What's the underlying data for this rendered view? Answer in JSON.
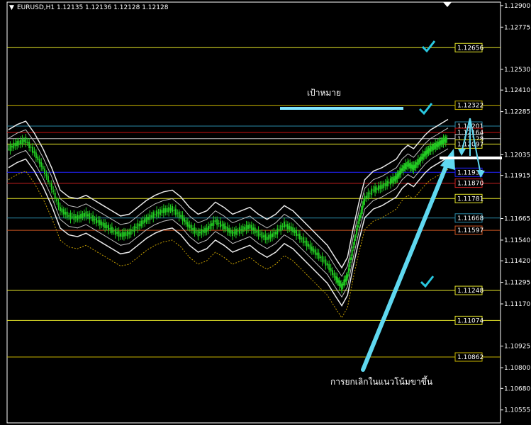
{
  "chart_data": {
    "type": "candlestick",
    "symbol_header": "EURUSD,H1  1.12135 1.12136 1.12128 1.12128",
    "ylim": [
      1.1048,
      1.1292
    ],
    "grid": false,
    "y_ticks": [
      "1.12900",
      "1.12775",
      "1.12530",
      "1.12410",
      "1.12285",
      "1.12035",
      "1.11915",
      "1.11665",
      "1.11540",
      "1.11420",
      "1.11295",
      "1.11170",
      "1.10925",
      "1.10800",
      "1.10680",
      "1.10555"
    ],
    "price_levels": [
      {
        "label": "1.12656",
        "value": 1.12656,
        "color": "#e6e629",
        "style": "solid"
      },
      {
        "label": "1.12322",
        "value": 1.12322,
        "color": "#c8b400",
        "style": "solid"
      },
      {
        "label": "1.12201",
        "value": 1.12201,
        "color": "#2a8aa8",
        "style": "solid"
      },
      {
        "label": "1.12164",
        "value": 1.12164,
        "color": "#cc1111",
        "style": "solid"
      },
      {
        "label": "1.12128",
        "value": 1.12128,
        "color": "#c0c0c0",
        "style": "solid"
      },
      {
        "label": "1.12097",
        "value": 1.12097,
        "color": "#e6e629",
        "style": "solid"
      },
      {
        "label": "1.11933",
        "value": 1.11933,
        "color": "#2222ff",
        "style": "solid"
      },
      {
        "label": "1.11870",
        "value": 1.1187,
        "color": "#cc2222",
        "style": "solid"
      },
      {
        "label": "1.11781",
        "value": 1.11781,
        "color": "#e6e629",
        "style": "solid"
      },
      {
        "label": "1.11668",
        "value": 1.11668,
        "color": "#2a8aa8",
        "style": "solid"
      },
      {
        "label": "1.11597",
        "value": 1.11597,
        "color": "#cc5522",
        "style": "solid"
      },
      {
        "label": "1.11248",
        "value": 1.11248,
        "color": "#e6e629",
        "style": "solid"
      },
      {
        "label": "1.11074",
        "value": 1.11074,
        "color": "#e6e629",
        "style": "solid"
      },
      {
        "label": "1.10862",
        "value": 1.10862,
        "color": "#c8b400",
        "style": "solid"
      }
    ],
    "annotations": {
      "target_label": "เป้าหมาย",
      "uptrend_label": "การยกเลิกในแนวโน้มขาขึ้น"
    },
    "price_path": [
      [
        0,
        1.1207
      ],
      [
        6,
        1.121
      ],
      [
        12,
        1.1212
      ],
      [
        18,
        1.1205
      ],
      [
        24,
        1.1196
      ],
      [
        30,
        1.1185
      ],
      [
        36,
        1.1172
      ],
      [
        42,
        1.1168
      ],
      [
        48,
        1.1167
      ],
      [
        54,
        1.1169
      ],
      [
        60,
        1.1166
      ],
      [
        66,
        1.1163
      ],
      [
        72,
        1.116
      ],
      [
        78,
        1.1157
      ],
      [
        84,
        1.1158
      ],
      [
        90,
        1.1162
      ],
      [
        96,
        1.1166
      ],
      [
        102,
        1.1169
      ],
      [
        108,
        1.1171
      ],
      [
        114,
        1.1172
      ],
      [
        120,
        1.1168
      ],
      [
        126,
        1.1162
      ],
      [
        132,
        1.1158
      ],
      [
        138,
        1.116
      ],
      [
        144,
        1.1165
      ],
      [
        150,
        1.1162
      ],
      [
        156,
        1.1158
      ],
      [
        162,
        1.116
      ],
      [
        168,
        1.1162
      ],
      [
        174,
        1.1158
      ],
      [
        180,
        1.1155
      ],
      [
        186,
        1.1158
      ],
      [
        192,
        1.1163
      ],
      [
        198,
        1.116
      ],
      [
        204,
        1.1155
      ],
      [
        210,
        1.115
      ],
      [
        216,
        1.1145
      ],
      [
        222,
        1.114
      ],
      [
        228,
        1.1132
      ],
      [
        232,
        1.1127
      ],
      [
        236,
        1.1133
      ],
      [
        240,
        1.115
      ],
      [
        244,
        1.1165
      ],
      [
        248,
        1.1178
      ],
      [
        254,
        1.1183
      ],
      [
        260,
        1.1185
      ],
      [
        266,
        1.1188
      ],
      [
        270,
        1.119
      ],
      [
        274,
        1.1195
      ],
      [
        278,
        1.1198
      ],
      [
        282,
        1.1196
      ],
      [
        286,
        1.12
      ],
      [
        290,
        1.1204
      ],
      [
        294,
        1.1207
      ],
      [
        298,
        1.1209
      ],
      [
        302,
        1.1211
      ],
      [
        306,
        1.1213
      ]
    ]
  },
  "icons": {
    "check_icon_color": "#29c8e0",
    "arrow_color": "#5fd8f0"
  }
}
